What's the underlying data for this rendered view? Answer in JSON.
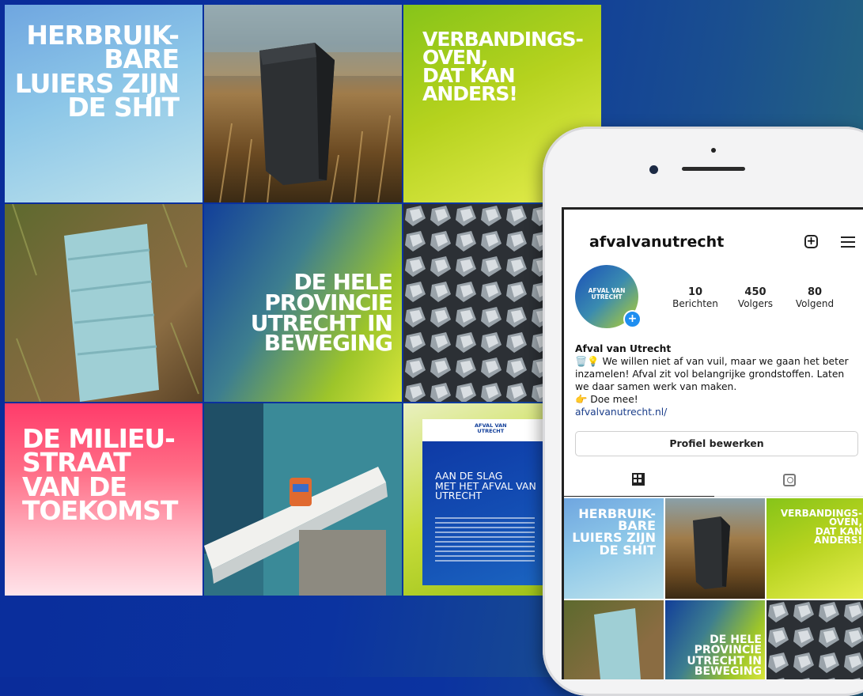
{
  "tiles": {
    "t1": "HERBRUIK-\nBARE\nLUIERS ZIJN\nDE SHIT",
    "t3": "VERBANDINGS-\nOVEN,\nDAT KAN\nANDERS!",
    "t5": "DE HELE\nPROVINCIE\nUTRECHT IN\nBEWEGING",
    "t7": "DE MILIEU-\nSTRAAT\nVAN DE\nTOEKOMST",
    "t9_logo": "AFVAL VAN\nUTRECHT",
    "t9_heading": "AAN DE SLAG\nMET HET AFVAL VAN\nUTRECHT"
  },
  "profile": {
    "username": "afvalvanutrecht",
    "avatar_text": "AFVAL VAN\nUTRECHT",
    "posts_count": "10",
    "posts_label": "Berichten",
    "followers_count": "450",
    "followers_label": "Volgers",
    "following_count": "80",
    "following_label": "Volgend",
    "name": "Afval van Utrecht",
    "bio": "🗑️💡 We willen niet af van vuil, maar we gaan het beter inzamelen! Afval zit vol belangrijke grondstoffen. Laten we daar samen werk van maken.",
    "cta": "👉 Doe mee!",
    "link": "afvalvanutrecht.nl/",
    "edit_button": "Profiel bewerken"
  },
  "icons": [
    "plus-square-icon",
    "menu-icon",
    "grid-icon",
    "tagged-icon",
    "add-story-icon"
  ]
}
